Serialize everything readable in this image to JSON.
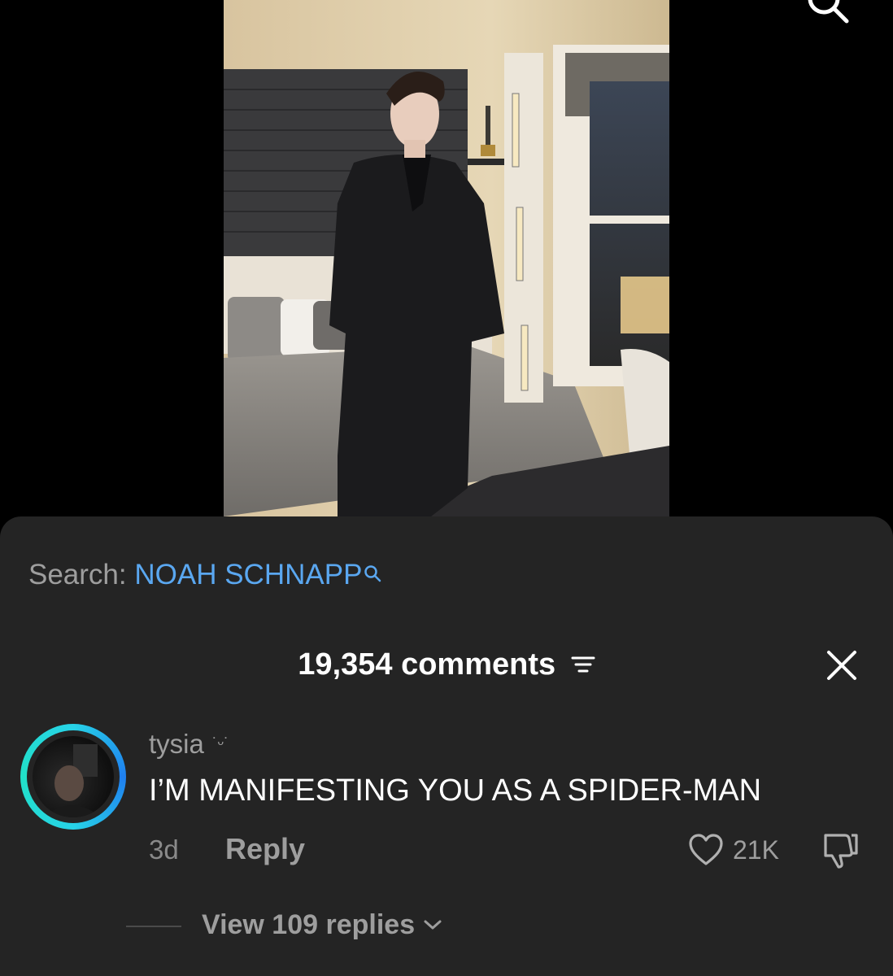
{
  "search": {
    "prefix": "Search:",
    "term": "NOAH SCHNAPP"
  },
  "comments": {
    "count_label": "19,354 comments"
  },
  "comment": {
    "username": "tysia",
    "username_decoration": "˙ᵕ˙",
    "text": "I’M MANIFESTING YOU AS A SPIDER-MAN",
    "time": "3d",
    "reply_label": "Reply",
    "like_count": "21K",
    "view_replies_label": "View 109 replies"
  },
  "colors": {
    "accent_link": "#5aa7f0",
    "sheet_bg": "#242424",
    "avatar_ring": "#27d3e7"
  },
  "icons": [
    "search-icon",
    "sort-icon",
    "close-icon",
    "heart-icon",
    "dislike-icon",
    "chevron-down-icon"
  ]
}
